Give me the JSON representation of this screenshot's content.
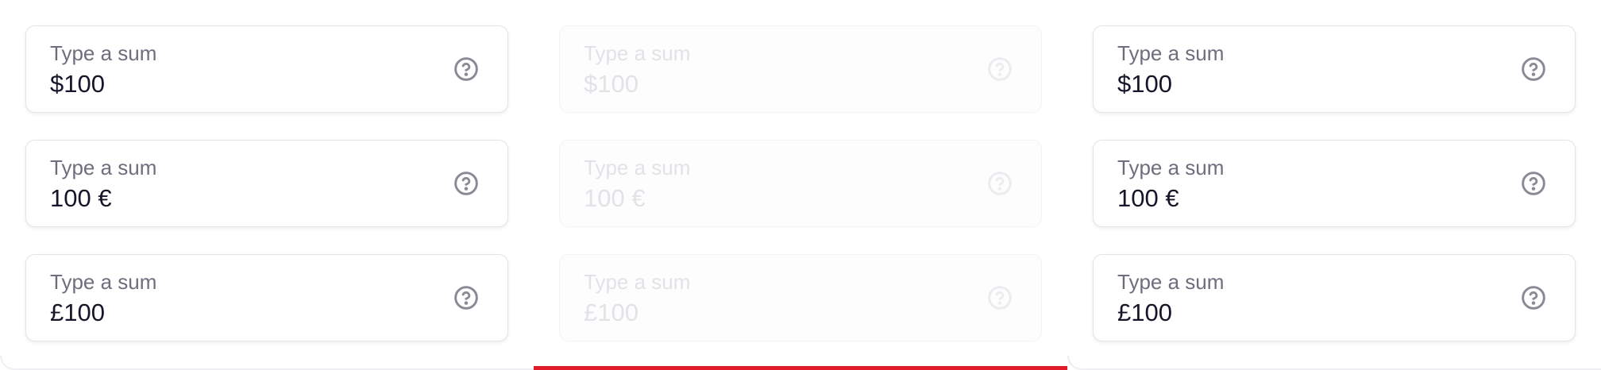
{
  "colors": {
    "accent": "#e21b2a",
    "text_primary": "#15162a",
    "text_label": "#6e6e7e",
    "icon": "#8a8a96"
  },
  "columns": [
    {
      "state": "default",
      "fields": [
        {
          "label": "Type a sum",
          "value": "$100",
          "icon": "help-circle-icon"
        },
        {
          "label": "Type a sum",
          "value": "100 €",
          "icon": "help-circle-icon"
        },
        {
          "label": "Type a sum",
          "value": "£100",
          "icon": "help-circle-icon"
        }
      ]
    },
    {
      "state": "disabled",
      "fields": [
        {
          "label": "Type a sum",
          "value": "$100",
          "icon": "help-circle-icon"
        },
        {
          "label": "Type a sum",
          "value": "100 €",
          "icon": "help-circle-icon"
        },
        {
          "label": "Type a sum",
          "value": "£100",
          "icon": "help-circle-icon"
        }
      ]
    },
    {
      "state": "default",
      "fields": [
        {
          "label": "Type a sum",
          "value": "$100",
          "icon": "help-circle-icon"
        },
        {
          "label": "Type a sum",
          "value": "100 €",
          "icon": "help-circle-icon"
        },
        {
          "label": "Type a sum",
          "value": "£100",
          "icon": "help-circle-icon"
        }
      ]
    }
  ]
}
